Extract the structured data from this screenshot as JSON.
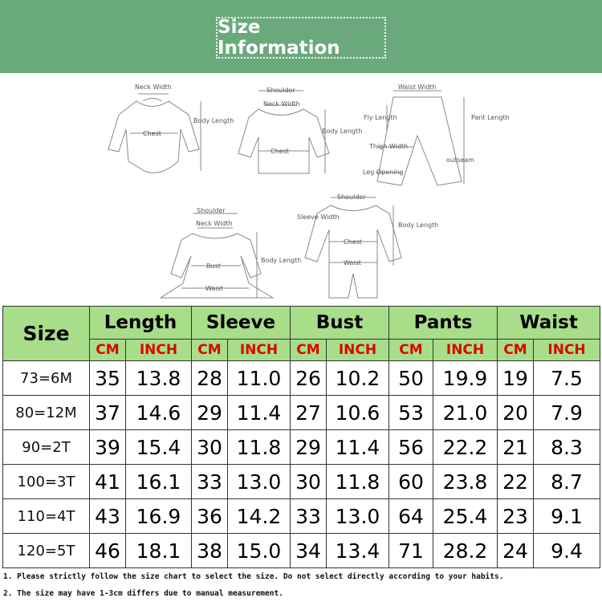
{
  "header": {
    "title": "Size Information",
    "bg_color": "#6aa97b"
  },
  "diagrams": {
    "bodysuit": {
      "neck_width": "Neck Width",
      "body_length": "Body Length",
      "chest": "Chest"
    },
    "top": {
      "shoulder": "Shoulder",
      "neck_width": "Neck Width",
      "body_length": "Body Length",
      "chest": "Chest"
    },
    "pants": {
      "waist_width": "Waist Width",
      "fly_length": "Fly Length",
      "pant_length": "Pant Length",
      "thigh_width": "Thigh Width",
      "outseam": "outseam",
      "leg_opening": "Leg Opening"
    },
    "dress": {
      "shoulder": "Shoulder",
      "neck_width": "Neck Width",
      "body_length": "Body Length",
      "bust": "Bust",
      "waist": "Waist"
    },
    "romper": {
      "shoulder": "Shoulder",
      "sleeve_width": "Sleeve Width",
      "body_length": "Body Length",
      "chest": "Chest",
      "waist": "Waist"
    }
  },
  "table": {
    "size_header": "Size",
    "groups": [
      "Length",
      "Sleeve",
      "Bust",
      "Pants",
      "Waist"
    ],
    "units": [
      "CM",
      "INCH"
    ],
    "header_color": "#a8de8a",
    "unit_color": "#e00000",
    "rows": [
      {
        "size": "73=6M",
        "values": [
          "35",
          "13.8",
          "28",
          "11.0",
          "26",
          "10.2",
          "50",
          "19.9",
          "19",
          "7.5"
        ]
      },
      {
        "size": "80=12M",
        "values": [
          "37",
          "14.6",
          "29",
          "11.4",
          "27",
          "10.6",
          "53",
          "21.0",
          "20",
          "7.9"
        ]
      },
      {
        "size": "90=2T",
        "values": [
          "39",
          "15.4",
          "30",
          "11.8",
          "29",
          "11.4",
          "56",
          "22.2",
          "21",
          "8.3"
        ]
      },
      {
        "size": "100=3T",
        "values": [
          "41",
          "16.1",
          "33",
          "13.0",
          "30",
          "11.8",
          "60",
          "23.8",
          "22",
          "8.7"
        ]
      },
      {
        "size": "110=4T",
        "values": [
          "43",
          "16.9",
          "36",
          "14.2",
          "33",
          "13.0",
          "64",
          "25.4",
          "23",
          "9.1"
        ]
      },
      {
        "size": "120=5T",
        "values": [
          "46",
          "18.1",
          "38",
          "15.0",
          "34",
          "13.4",
          "71",
          "28.2",
          "24",
          "9.4"
        ]
      }
    ]
  },
  "notes": [
    "1. Please strictly follow the size chart to select the size. Do not select directly according to your habits.",
    "2. The size may have 1-3cm differs due to manual measurement."
  ]
}
